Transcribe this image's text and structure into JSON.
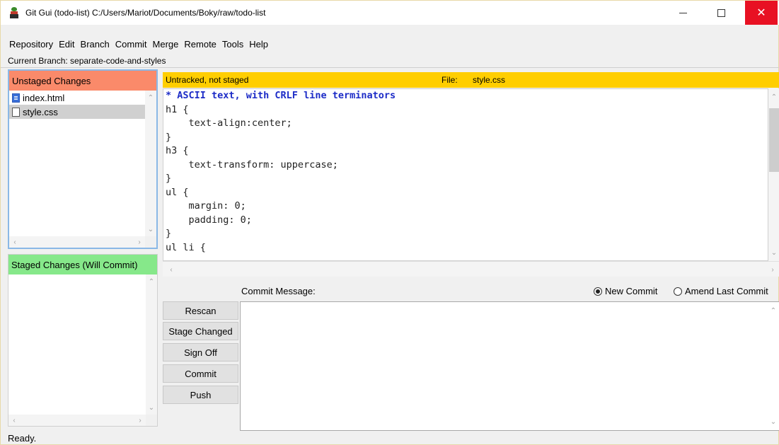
{
  "window": {
    "title": "Git Gui (todo-list) C:/Users/Mariot/Documents/Boky/raw/todo-list",
    "close_color": "#e81123"
  },
  "menu": [
    "Repository",
    "Edit",
    "Branch",
    "Commit",
    "Merge",
    "Remote",
    "Tools",
    "Help"
  ],
  "current_branch": "Current Branch: separate-code-and-styles",
  "unstaged": {
    "header": "Unstaged Changes",
    "header_color": "#fa8a6a",
    "files": [
      {
        "name": "index.html",
        "icon": "html-file-icon"
      },
      {
        "name": "style.css",
        "icon": "text-file-icon",
        "selected": true
      }
    ]
  },
  "staged": {
    "header": "Staged Changes (Will Commit)",
    "header_color": "#86e88a",
    "files": []
  },
  "diff": {
    "status": "Untracked, not staged",
    "file_label": "File:",
    "file_name": "style.css",
    "header_color": "#ffce00",
    "lines": [
      "* ASCII text, with CRLF line terminators",
      "h1 {",
      "    text-align:center;",
      "}",
      "h3 {",
      "    text-transform: uppercase;",
      "}",
      "ul {",
      "    margin: 0;",
      "    padding: 0;",
      "}",
      "ul li {"
    ]
  },
  "commit": {
    "label": "Commit Message:",
    "new_commit": "New Commit",
    "amend": "Amend Last Commit",
    "message": ""
  },
  "buttons": {
    "rescan": "Rescan",
    "stage_changed": "Stage Changed",
    "sign_off": "Sign Off",
    "commit": "Commit",
    "push": "Push"
  },
  "status": "Ready."
}
